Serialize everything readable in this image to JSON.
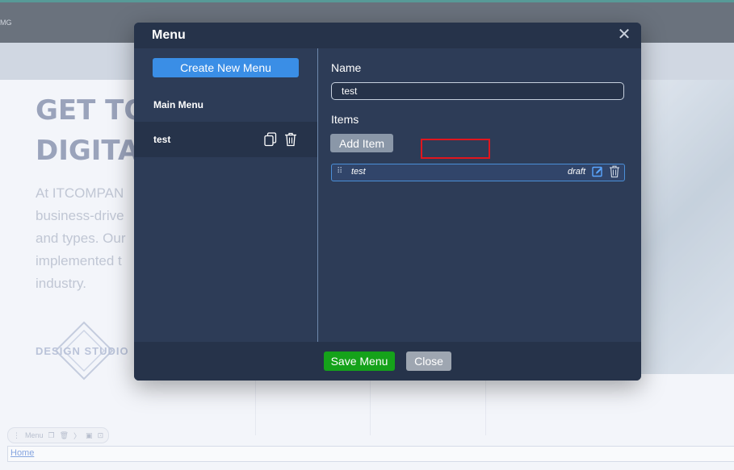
{
  "background": {
    "header_text": "MG",
    "hero_heading_line1": "GET TO",
    "hero_heading_line2": "DIGITAL",
    "hero_paragraph": "At ITCOMPAN\nbusiness-drive\nand types. Our\nimplemented t\nindustry.",
    "logo_text": "DESIGN STUDIO",
    "bottom_tool_label": "Menu",
    "bottom_field_text": "Home"
  },
  "modal": {
    "title": "Menu",
    "close_icon": "close-x-icon",
    "create_button_label": "Create New Menu",
    "menus": [
      {
        "label": "Main Menu"
      },
      {
        "label": "test",
        "selected": true
      }
    ],
    "name_label": "Name",
    "name_value": "test",
    "items_label": "Items",
    "add_item_label": "Add Item",
    "items": [
      {
        "label": "test",
        "status": "draft"
      }
    ],
    "save_label": "Save Menu",
    "close_label": "Close"
  },
  "colors": {
    "modal_bg": "#2d3c57",
    "header_bg": "#26334a",
    "primary": "#3a8ee6",
    "success": "#15a21a",
    "highlight": "#e0161e"
  }
}
